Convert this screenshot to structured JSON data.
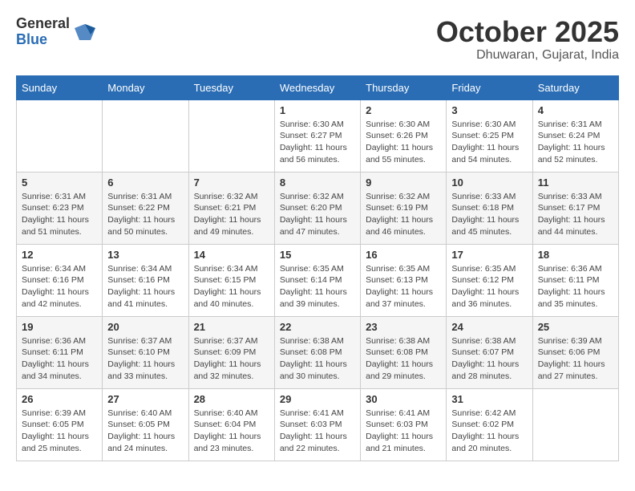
{
  "header": {
    "logo_general": "General",
    "logo_blue": "Blue",
    "month_title": "October 2025",
    "location": "Dhuwaran, Gujarat, India"
  },
  "weekdays": [
    "Sunday",
    "Monday",
    "Tuesday",
    "Wednesday",
    "Thursday",
    "Friday",
    "Saturday"
  ],
  "weeks": [
    [
      {
        "day": "",
        "info": ""
      },
      {
        "day": "",
        "info": ""
      },
      {
        "day": "",
        "info": ""
      },
      {
        "day": "1",
        "info": "Sunrise: 6:30 AM\nSunset: 6:27 PM\nDaylight: 11 hours\nand 56 minutes."
      },
      {
        "day": "2",
        "info": "Sunrise: 6:30 AM\nSunset: 6:26 PM\nDaylight: 11 hours\nand 55 minutes."
      },
      {
        "day": "3",
        "info": "Sunrise: 6:30 AM\nSunset: 6:25 PM\nDaylight: 11 hours\nand 54 minutes."
      },
      {
        "day": "4",
        "info": "Sunrise: 6:31 AM\nSunset: 6:24 PM\nDaylight: 11 hours\nand 52 minutes."
      }
    ],
    [
      {
        "day": "5",
        "info": "Sunrise: 6:31 AM\nSunset: 6:23 PM\nDaylight: 11 hours\nand 51 minutes."
      },
      {
        "day": "6",
        "info": "Sunrise: 6:31 AM\nSunset: 6:22 PM\nDaylight: 11 hours\nand 50 minutes."
      },
      {
        "day": "7",
        "info": "Sunrise: 6:32 AM\nSunset: 6:21 PM\nDaylight: 11 hours\nand 49 minutes."
      },
      {
        "day": "8",
        "info": "Sunrise: 6:32 AM\nSunset: 6:20 PM\nDaylight: 11 hours\nand 47 minutes."
      },
      {
        "day": "9",
        "info": "Sunrise: 6:32 AM\nSunset: 6:19 PM\nDaylight: 11 hours\nand 46 minutes."
      },
      {
        "day": "10",
        "info": "Sunrise: 6:33 AM\nSunset: 6:18 PM\nDaylight: 11 hours\nand 45 minutes."
      },
      {
        "day": "11",
        "info": "Sunrise: 6:33 AM\nSunset: 6:17 PM\nDaylight: 11 hours\nand 44 minutes."
      }
    ],
    [
      {
        "day": "12",
        "info": "Sunrise: 6:34 AM\nSunset: 6:16 PM\nDaylight: 11 hours\nand 42 minutes."
      },
      {
        "day": "13",
        "info": "Sunrise: 6:34 AM\nSunset: 6:16 PM\nDaylight: 11 hours\nand 41 minutes."
      },
      {
        "day": "14",
        "info": "Sunrise: 6:34 AM\nSunset: 6:15 PM\nDaylight: 11 hours\nand 40 minutes."
      },
      {
        "day": "15",
        "info": "Sunrise: 6:35 AM\nSunset: 6:14 PM\nDaylight: 11 hours\nand 39 minutes."
      },
      {
        "day": "16",
        "info": "Sunrise: 6:35 AM\nSunset: 6:13 PM\nDaylight: 11 hours\nand 37 minutes."
      },
      {
        "day": "17",
        "info": "Sunrise: 6:35 AM\nSunset: 6:12 PM\nDaylight: 11 hours\nand 36 minutes."
      },
      {
        "day": "18",
        "info": "Sunrise: 6:36 AM\nSunset: 6:11 PM\nDaylight: 11 hours\nand 35 minutes."
      }
    ],
    [
      {
        "day": "19",
        "info": "Sunrise: 6:36 AM\nSunset: 6:11 PM\nDaylight: 11 hours\nand 34 minutes."
      },
      {
        "day": "20",
        "info": "Sunrise: 6:37 AM\nSunset: 6:10 PM\nDaylight: 11 hours\nand 33 minutes."
      },
      {
        "day": "21",
        "info": "Sunrise: 6:37 AM\nSunset: 6:09 PM\nDaylight: 11 hours\nand 32 minutes."
      },
      {
        "day": "22",
        "info": "Sunrise: 6:38 AM\nSunset: 6:08 PM\nDaylight: 11 hours\nand 30 minutes."
      },
      {
        "day": "23",
        "info": "Sunrise: 6:38 AM\nSunset: 6:08 PM\nDaylight: 11 hours\nand 29 minutes."
      },
      {
        "day": "24",
        "info": "Sunrise: 6:38 AM\nSunset: 6:07 PM\nDaylight: 11 hours\nand 28 minutes."
      },
      {
        "day": "25",
        "info": "Sunrise: 6:39 AM\nSunset: 6:06 PM\nDaylight: 11 hours\nand 27 minutes."
      }
    ],
    [
      {
        "day": "26",
        "info": "Sunrise: 6:39 AM\nSunset: 6:05 PM\nDaylight: 11 hours\nand 25 minutes."
      },
      {
        "day": "27",
        "info": "Sunrise: 6:40 AM\nSunset: 6:05 PM\nDaylight: 11 hours\nand 24 minutes."
      },
      {
        "day": "28",
        "info": "Sunrise: 6:40 AM\nSunset: 6:04 PM\nDaylight: 11 hours\nand 23 minutes."
      },
      {
        "day": "29",
        "info": "Sunrise: 6:41 AM\nSunset: 6:03 PM\nDaylight: 11 hours\nand 22 minutes."
      },
      {
        "day": "30",
        "info": "Sunrise: 6:41 AM\nSunset: 6:03 PM\nDaylight: 11 hours\nand 21 minutes."
      },
      {
        "day": "31",
        "info": "Sunrise: 6:42 AM\nSunset: 6:02 PM\nDaylight: 11 hours\nand 20 minutes."
      },
      {
        "day": "",
        "info": ""
      }
    ]
  ]
}
